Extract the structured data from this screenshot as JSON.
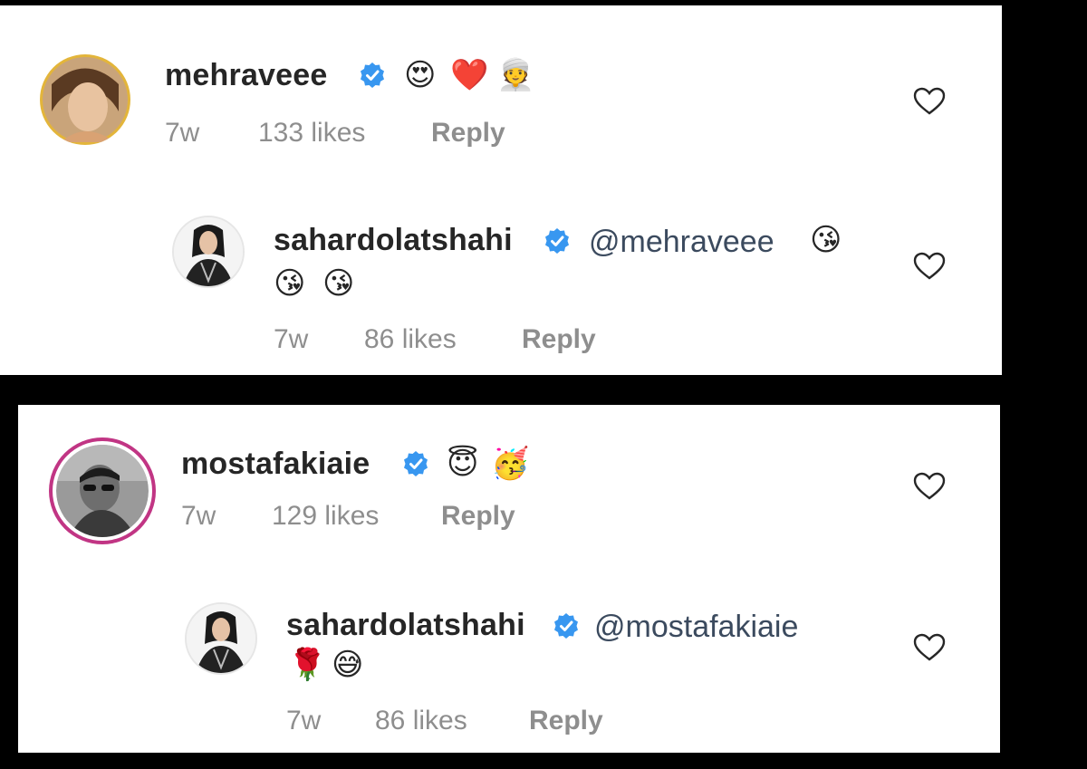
{
  "comments": [
    {
      "username": "mehraveee",
      "emojis": [
        "😍",
        "❤️",
        "👳"
      ],
      "time": "7w",
      "likes": "133 likes",
      "reply_label": "Reply",
      "reply": {
        "username": "sahardolatshahi",
        "mention": "@mehraveee",
        "emojis_inline": [
          "😘"
        ],
        "emojis_line2": [
          "😘",
          "😘"
        ],
        "time": "7w",
        "likes": "86 likes",
        "reply_label": "Reply"
      }
    },
    {
      "username": "mostafakiaie",
      "emojis": [
        "😇",
        "🥳"
      ],
      "time": "7w",
      "likes": "129 likes",
      "reply_label": "Reply",
      "reply": {
        "username": "sahardolatshahi",
        "mention": "@mostafakiaie",
        "emojis_line2": [
          "🌹",
          "😅"
        ],
        "time": "7w",
        "likes": "86 likes",
        "reply_label": "Reply"
      }
    }
  ],
  "colors": {
    "verified_blue": "#3897f0",
    "text_primary": "#262626",
    "text_secondary": "#8e8e8e",
    "background": "#000000",
    "card": "#ffffff"
  },
  "icons": {
    "verified": "verified-badge-icon",
    "like": "heart-outline-icon"
  }
}
